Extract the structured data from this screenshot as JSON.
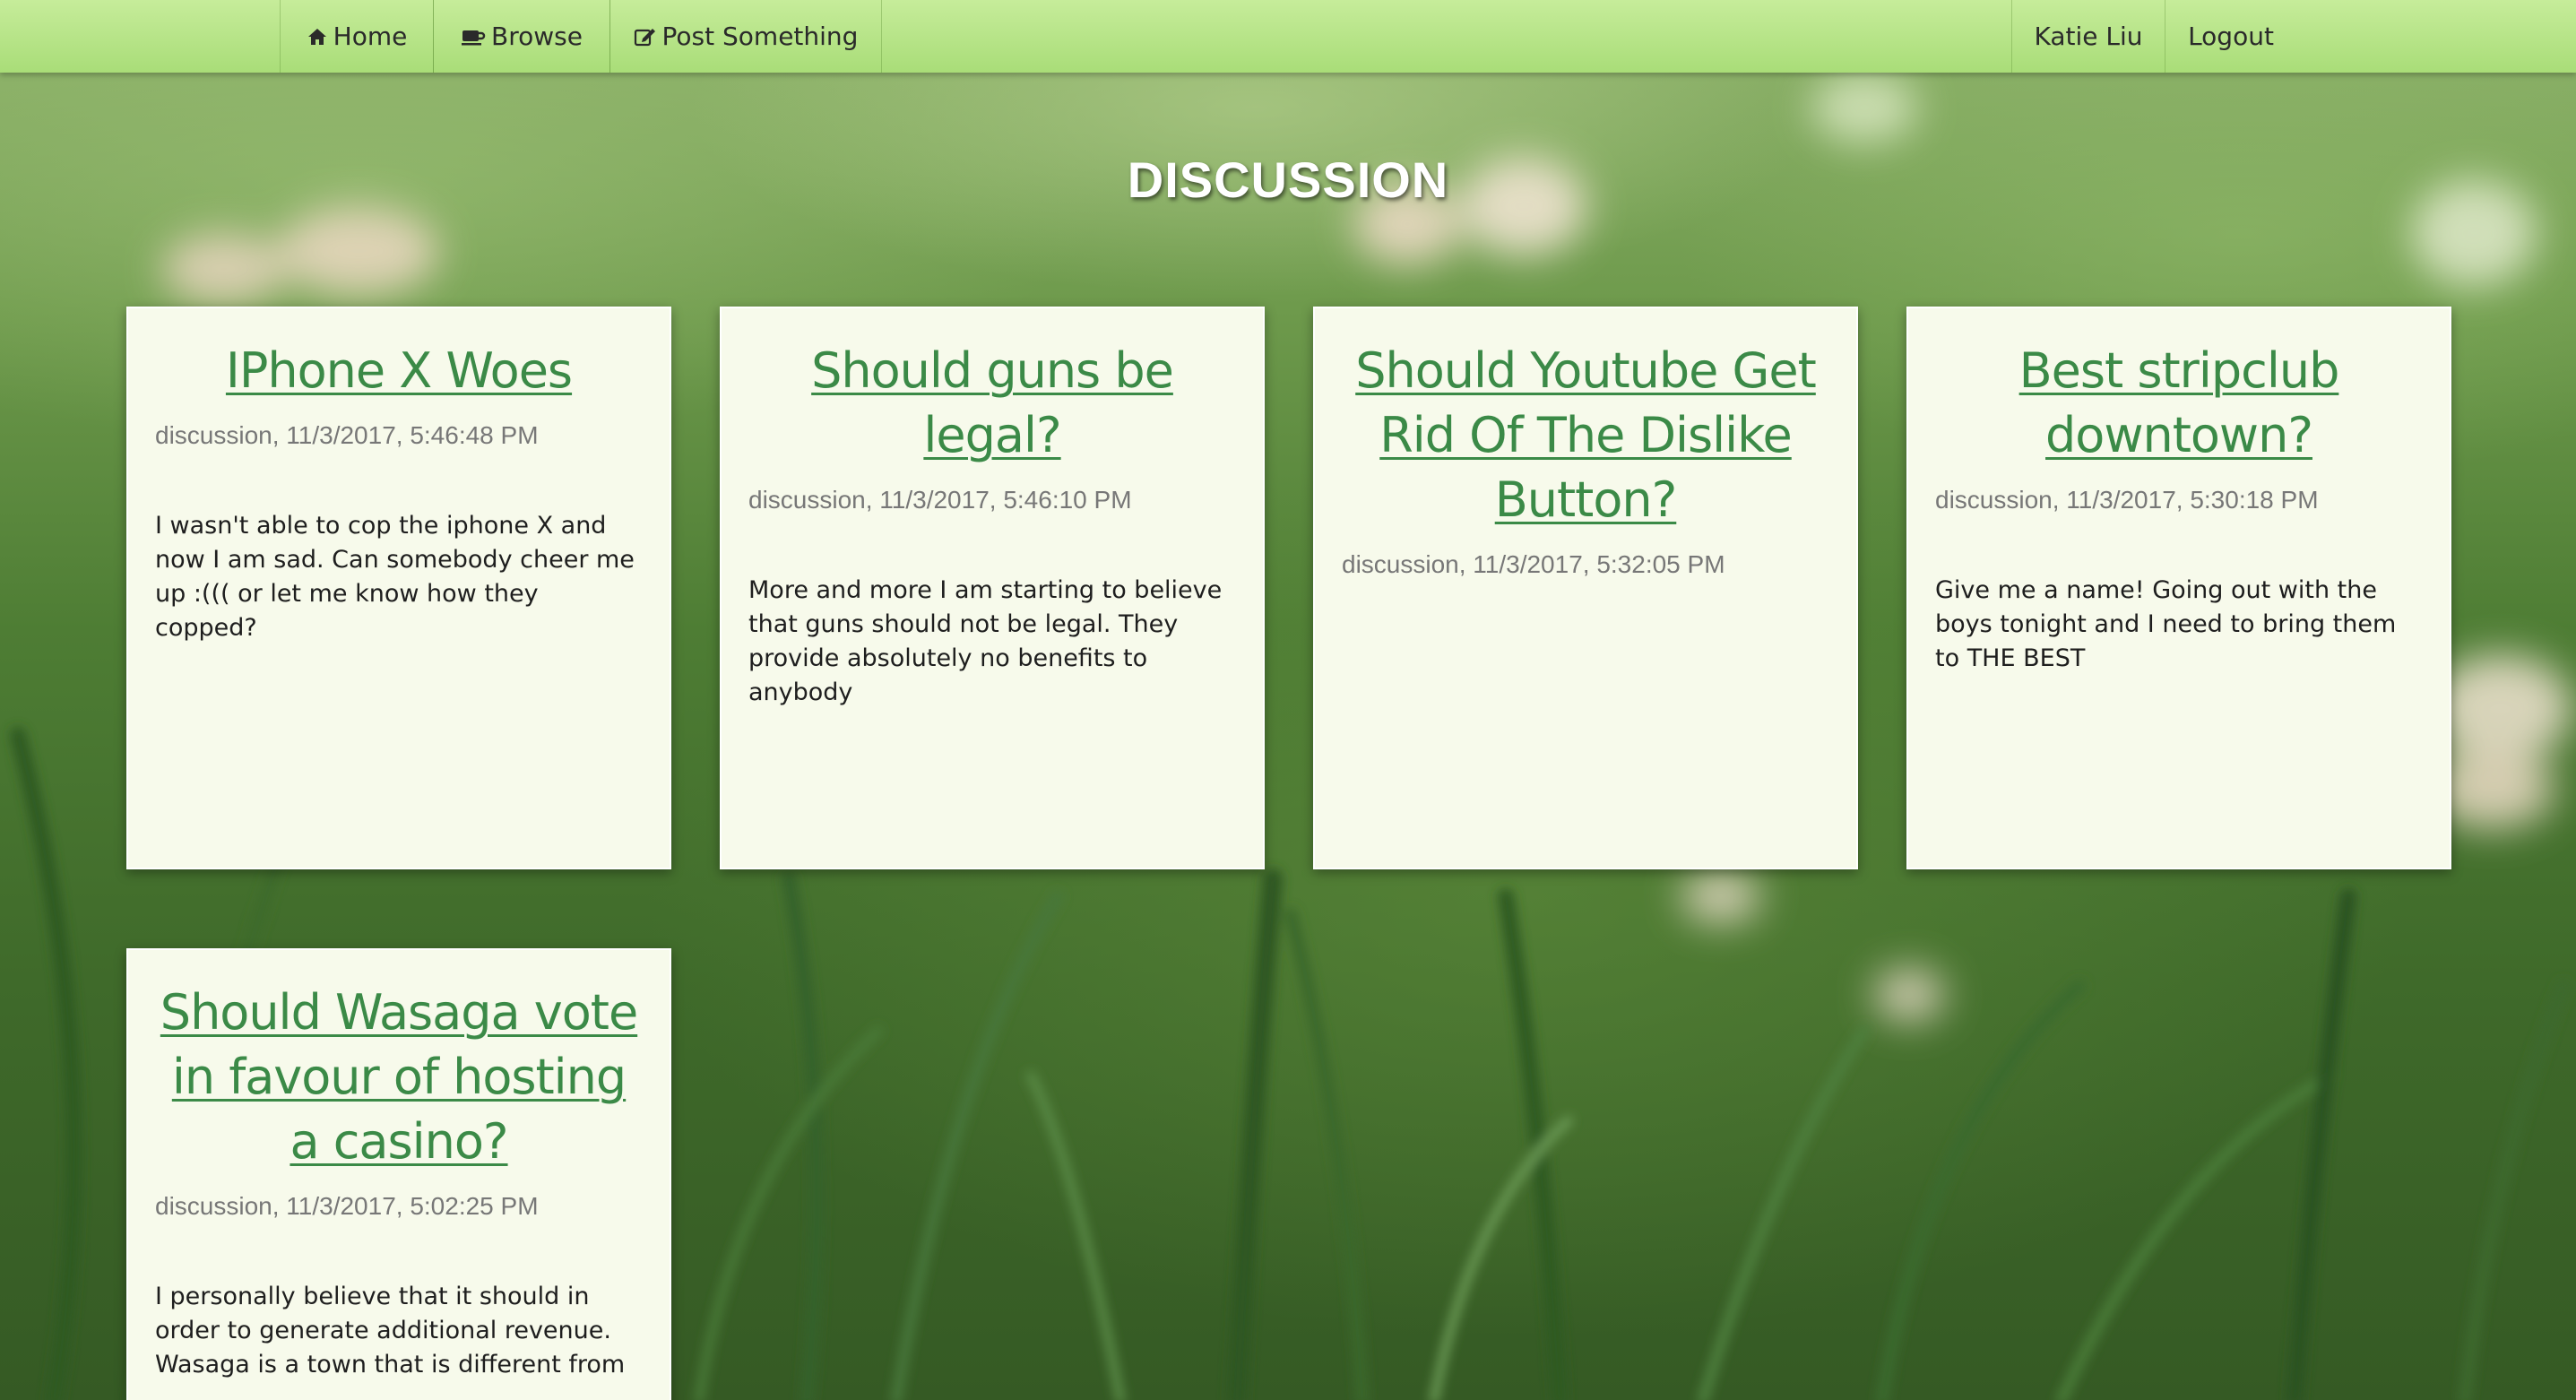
{
  "navbar": {
    "home": {
      "label": "Home",
      "icon": "home-icon"
    },
    "browse": {
      "label": "Browse",
      "icon": "coffee-cup-icon"
    },
    "post": {
      "label": "Post Something",
      "icon": "edit-icon"
    },
    "user": {
      "label": "Katie Liu"
    },
    "logout": {
      "label": "Logout"
    }
  },
  "page": {
    "title": "DISCUSSION"
  },
  "colors": {
    "navbar": "#b6e386",
    "card_background": "#f7faeb",
    "title_link": "#3b8a47",
    "meta_text": "#777777"
  },
  "posts": [
    {
      "title": "IPhone X Woes",
      "meta": "discussion, 11/3/2017, 5:46:48 PM",
      "body": "I wasn't able to cop the iphone X and now I am sad. Can somebody cheer me up :((( or let me know how they copped?"
    },
    {
      "title": "Should guns be legal?",
      "meta": "discussion, 11/3/2017, 5:46:10 PM",
      "body": "More and more I am starting to believe that guns should not be legal. They provide absolutely no benefits to anybody"
    },
    {
      "title": "Should Youtube Get Rid Of The Dislike Button?",
      "meta": "discussion, 11/3/2017, 5:32:05 PM",
      "body": ""
    },
    {
      "title": "Best stripclub downtown?",
      "meta": "discussion, 11/3/2017, 5:30:18 PM",
      "body": "Give me a name! Going out with the boys tonight and I need to bring them to THE BEST"
    },
    {
      "title": "Should Wasaga vote in favour of hosting a casino?",
      "meta": "discussion, 11/3/2017, 5:02:25 PM",
      "body": "I personally believe that it should in order to generate additional revenue. Wasaga is a town that is different from"
    }
  ]
}
